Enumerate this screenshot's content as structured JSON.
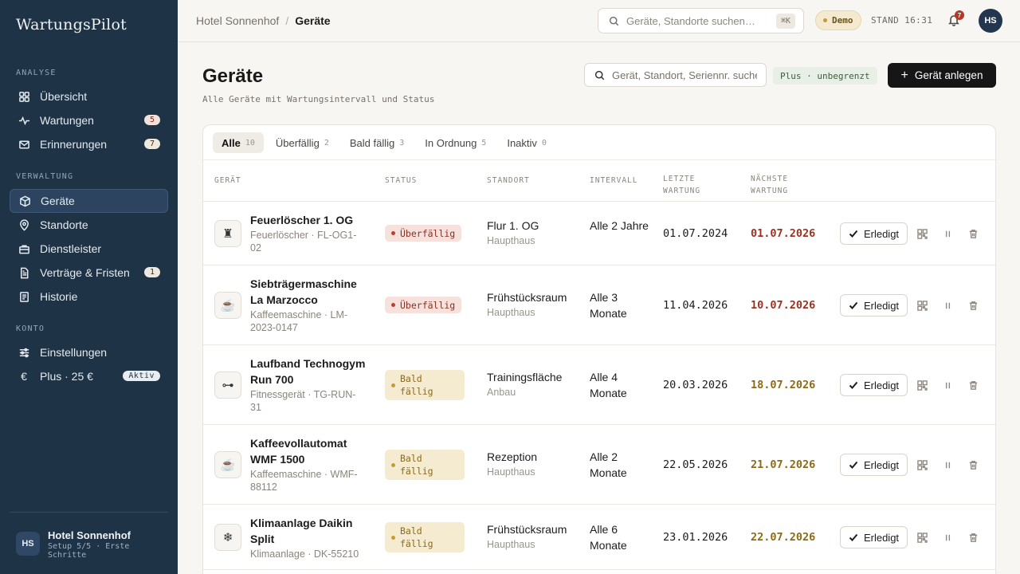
{
  "app": {
    "name": "WartungsPilot"
  },
  "sidebar": {
    "sections": [
      {
        "title": "ANALYSE"
      },
      {
        "title": "VERWALTUNG"
      },
      {
        "title": "KONTO"
      }
    ],
    "items": [
      {
        "label": "Übersicht",
        "icon": "grid-icon"
      },
      {
        "label": "Wartungen",
        "icon": "activity-icon",
        "count": "5"
      },
      {
        "label": "Erinnerungen",
        "icon": "mail-icon",
        "count": "7"
      },
      {
        "label": "Geräte",
        "icon": "box-icon",
        "active": true
      },
      {
        "label": "Standorte",
        "icon": "map-pin-icon"
      },
      {
        "label": "Dienstleister",
        "icon": "briefcase-icon"
      },
      {
        "label": "Verträge & Fristen",
        "icon": "document-icon",
        "count": "1"
      },
      {
        "label": "Historie",
        "icon": "history-icon"
      },
      {
        "label": "Einstellungen",
        "icon": "sliders-icon"
      },
      {
        "label": "Plus · 25 €",
        "icon": "euro-icon",
        "tag": "Aktiv"
      }
    ],
    "user": {
      "initials": "HS",
      "name": "Hotel Sonnenhof",
      "sub": "Setup 5/5 · Erste Schritte"
    }
  },
  "topbar": {
    "breadcrumb": [
      "Hotel Sonnenhof",
      "/",
      "Geräte"
    ],
    "search_placeholder": "Geräte, Standorte suchen…",
    "shortcut": "⌘K",
    "demo": "Demo",
    "stand": "STAND 16:31",
    "notifications": "7",
    "avatar": "HS"
  },
  "page": {
    "title": "Geräte",
    "subtitle": "Alle Geräte mit Wartungsintervall und Status",
    "search_placeholder": "Gerät, Standort, Seriennr. suchen",
    "plan": "Plus · unbegrenzt",
    "add_button": "Gerät anlegen"
  },
  "tabs": [
    {
      "label": "Alle",
      "count": "10",
      "active": true
    },
    {
      "label": "Überfällig",
      "count": "2"
    },
    {
      "label": "Bald fällig",
      "count": "3"
    },
    {
      "label": "In Ordnung",
      "count": "5"
    },
    {
      "label": "Inaktiv",
      "count": "0"
    }
  ],
  "columns": {
    "device": "GERÄT",
    "status": "STATUS",
    "location": "STANDORT",
    "interval": "INTERVALL",
    "last": "LETZTE WARTUNG",
    "next": "NÄCHSTE WARTUNG"
  },
  "done_label": "Erledigt",
  "rows": [
    {
      "icon": "fire-extinguisher-icon",
      "glyph": "♜",
      "name": "Feuerlöscher 1. OG",
      "sub": "Feuerlöscher · FL-OG1-02",
      "status": "Überfällig",
      "status_kind": "over",
      "location": "Flur 1. OG",
      "building": "Haupthaus",
      "interval": "Alle 2 Jahre",
      "last": "01.07.2024",
      "next": "01.07.2026"
    },
    {
      "icon": "coffee-machine-icon",
      "glyph": "☕",
      "name": "Siebträgermaschine La Marzocco",
      "sub": "Kaffeemaschine · LM-2023-0147",
      "status": "Überfällig",
      "status_kind": "over",
      "location": "Frühstücksraum",
      "building": "Haupthaus",
      "interval": "Alle 3 Monate",
      "last": "11.04.2026",
      "next": "10.07.2026"
    },
    {
      "icon": "treadmill-icon",
      "glyph": "⊶",
      "name": "Laufband Technogym Run 700",
      "sub": "Fitnessgerät · TG-RUN-31",
      "status": "Bald fällig",
      "status_kind": "soon",
      "location": "Trainingsfläche",
      "building": "Anbau",
      "interval": "Alle 4 Monate",
      "last": "20.03.2026",
      "next": "18.07.2026"
    },
    {
      "icon": "coffee-machine-icon",
      "glyph": "☕",
      "name": "Kaffeevollautomat WMF 1500",
      "sub": "Kaffeemaschine · WMF-88112",
      "status": "Bald fällig",
      "status_kind": "soon",
      "location": "Rezeption",
      "building": "Haupthaus",
      "interval": "Alle 2 Monate",
      "last": "22.05.2026",
      "next": "21.07.2026"
    },
    {
      "icon": "snowflake-icon",
      "glyph": "❄",
      "name": "Klimaanlage Daikin Split",
      "sub": "Klimaanlage · DK-55210",
      "status": "Bald fällig",
      "status_kind": "soon",
      "location": "Frühstücksraum",
      "building": "Haupthaus",
      "interval": "Alle 6 Monate",
      "last": "23.01.2026",
      "next": "22.07.2026"
    }
  ]
}
